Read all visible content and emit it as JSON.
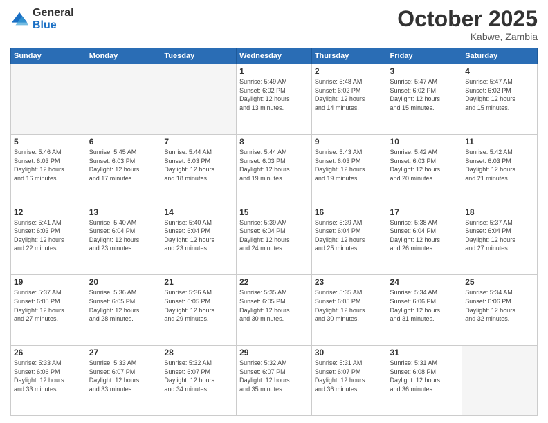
{
  "header": {
    "logo_general": "General",
    "logo_blue": "Blue",
    "month_title": "October 2025",
    "location": "Kabwe, Zambia"
  },
  "days_of_week": [
    "Sunday",
    "Monday",
    "Tuesday",
    "Wednesday",
    "Thursday",
    "Friday",
    "Saturday"
  ],
  "weeks": [
    [
      {
        "day": "",
        "info": ""
      },
      {
        "day": "",
        "info": ""
      },
      {
        "day": "",
        "info": ""
      },
      {
        "day": "1",
        "info": "Sunrise: 5:49 AM\nSunset: 6:02 PM\nDaylight: 12 hours\nand 13 minutes."
      },
      {
        "day": "2",
        "info": "Sunrise: 5:48 AM\nSunset: 6:02 PM\nDaylight: 12 hours\nand 14 minutes."
      },
      {
        "day": "3",
        "info": "Sunrise: 5:47 AM\nSunset: 6:02 PM\nDaylight: 12 hours\nand 15 minutes."
      },
      {
        "day": "4",
        "info": "Sunrise: 5:47 AM\nSunset: 6:02 PM\nDaylight: 12 hours\nand 15 minutes."
      }
    ],
    [
      {
        "day": "5",
        "info": "Sunrise: 5:46 AM\nSunset: 6:03 PM\nDaylight: 12 hours\nand 16 minutes."
      },
      {
        "day": "6",
        "info": "Sunrise: 5:45 AM\nSunset: 6:03 PM\nDaylight: 12 hours\nand 17 minutes."
      },
      {
        "day": "7",
        "info": "Sunrise: 5:44 AM\nSunset: 6:03 PM\nDaylight: 12 hours\nand 18 minutes."
      },
      {
        "day": "8",
        "info": "Sunrise: 5:44 AM\nSunset: 6:03 PM\nDaylight: 12 hours\nand 19 minutes."
      },
      {
        "day": "9",
        "info": "Sunrise: 5:43 AM\nSunset: 6:03 PM\nDaylight: 12 hours\nand 19 minutes."
      },
      {
        "day": "10",
        "info": "Sunrise: 5:42 AM\nSunset: 6:03 PM\nDaylight: 12 hours\nand 20 minutes."
      },
      {
        "day": "11",
        "info": "Sunrise: 5:42 AM\nSunset: 6:03 PM\nDaylight: 12 hours\nand 21 minutes."
      }
    ],
    [
      {
        "day": "12",
        "info": "Sunrise: 5:41 AM\nSunset: 6:03 PM\nDaylight: 12 hours\nand 22 minutes."
      },
      {
        "day": "13",
        "info": "Sunrise: 5:40 AM\nSunset: 6:04 PM\nDaylight: 12 hours\nand 23 minutes."
      },
      {
        "day": "14",
        "info": "Sunrise: 5:40 AM\nSunset: 6:04 PM\nDaylight: 12 hours\nand 23 minutes."
      },
      {
        "day": "15",
        "info": "Sunrise: 5:39 AM\nSunset: 6:04 PM\nDaylight: 12 hours\nand 24 minutes."
      },
      {
        "day": "16",
        "info": "Sunrise: 5:39 AM\nSunset: 6:04 PM\nDaylight: 12 hours\nand 25 minutes."
      },
      {
        "day": "17",
        "info": "Sunrise: 5:38 AM\nSunset: 6:04 PM\nDaylight: 12 hours\nand 26 minutes."
      },
      {
        "day": "18",
        "info": "Sunrise: 5:37 AM\nSunset: 6:04 PM\nDaylight: 12 hours\nand 27 minutes."
      }
    ],
    [
      {
        "day": "19",
        "info": "Sunrise: 5:37 AM\nSunset: 6:05 PM\nDaylight: 12 hours\nand 27 minutes."
      },
      {
        "day": "20",
        "info": "Sunrise: 5:36 AM\nSunset: 6:05 PM\nDaylight: 12 hours\nand 28 minutes."
      },
      {
        "day": "21",
        "info": "Sunrise: 5:36 AM\nSunset: 6:05 PM\nDaylight: 12 hours\nand 29 minutes."
      },
      {
        "day": "22",
        "info": "Sunrise: 5:35 AM\nSunset: 6:05 PM\nDaylight: 12 hours\nand 30 minutes."
      },
      {
        "day": "23",
        "info": "Sunrise: 5:35 AM\nSunset: 6:05 PM\nDaylight: 12 hours\nand 30 minutes."
      },
      {
        "day": "24",
        "info": "Sunrise: 5:34 AM\nSunset: 6:06 PM\nDaylight: 12 hours\nand 31 minutes."
      },
      {
        "day": "25",
        "info": "Sunrise: 5:34 AM\nSunset: 6:06 PM\nDaylight: 12 hours\nand 32 minutes."
      }
    ],
    [
      {
        "day": "26",
        "info": "Sunrise: 5:33 AM\nSunset: 6:06 PM\nDaylight: 12 hours\nand 33 minutes."
      },
      {
        "day": "27",
        "info": "Sunrise: 5:33 AM\nSunset: 6:07 PM\nDaylight: 12 hours\nand 33 minutes."
      },
      {
        "day": "28",
        "info": "Sunrise: 5:32 AM\nSunset: 6:07 PM\nDaylight: 12 hours\nand 34 minutes."
      },
      {
        "day": "29",
        "info": "Sunrise: 5:32 AM\nSunset: 6:07 PM\nDaylight: 12 hours\nand 35 minutes."
      },
      {
        "day": "30",
        "info": "Sunrise: 5:31 AM\nSunset: 6:07 PM\nDaylight: 12 hours\nand 36 minutes."
      },
      {
        "day": "31",
        "info": "Sunrise: 5:31 AM\nSunset: 6:08 PM\nDaylight: 12 hours\nand 36 minutes."
      },
      {
        "day": "",
        "info": ""
      }
    ]
  ]
}
